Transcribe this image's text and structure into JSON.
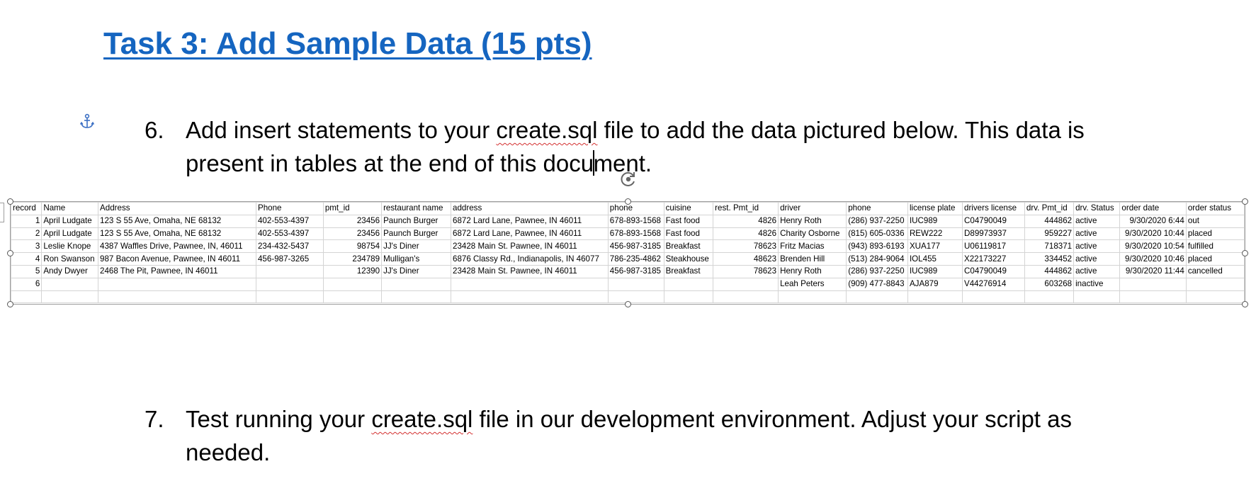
{
  "heading": "Task 3: Add Sample Data (15 pts)",
  "item6": {
    "number": "6.",
    "line1_pre": "Add insert statements to your ",
    "line1_file": "create.sql",
    "line1_post": " file to add the data pictured below. This data is",
    "line2_pre": "present in tables at the end of this docu",
    "line2_post": "ment."
  },
  "item7": {
    "number": "7.",
    "line1_pre": "Test running your ",
    "line1_file": "create.sql",
    "line1_post": " file in our development environment. Adjust your script as",
    "line2": "needed."
  },
  "table": {
    "headers": [
      "record",
      "Name",
      "Address",
      "Phone",
      "pmt_id",
      "restaurant name",
      "address",
      "phone",
      "cuisine",
      "rest. Pmt_id",
      "driver",
      "phone",
      "license plate",
      "drivers license",
      "drv. Pmt_id",
      "drv. Status",
      "order date",
      "order status"
    ],
    "numeric_columns": [
      0,
      4,
      9,
      14,
      16
    ],
    "rows": [
      [
        "1",
        "April Ludgate",
        "123 S 55 Ave, Omaha, NE 68132",
        "402-553-4397",
        "23456",
        "Paunch Burger",
        "6872 Lard Lane, Pawnee, IN 46011",
        "678-893-1568",
        "Fast food",
        "4826",
        "Henry Roth",
        "(286) 937-2250",
        "IUC989",
        "C04790049",
        "444862",
        "active",
        "9/30/2020 6:44",
        "out"
      ],
      [
        "2",
        "April Ludgate",
        "123 S 55 Ave, Omaha, NE 68132",
        "402-553-4397",
        "23456",
        "Paunch Burger",
        "6872 Lard Lane, Pawnee, IN 46011",
        "678-893-1568",
        "Fast food",
        "4826",
        "Charity Osborne",
        "(815) 605-0336",
        "REW222",
        "D89973937",
        "959227",
        "active",
        "9/30/2020 10:44",
        "placed"
      ],
      [
        "3",
        "Leslie Knope",
        "4387 Waffles Drive, Pawnee, IN, 46011",
        "234-432-5437",
        "98754",
        "JJ's Diner",
        "23428 Main St. Pawnee, IN 46011",
        "456-987-3185",
        "Breakfast",
        "78623",
        "Fritz Macias",
        "(943) 893-6193",
        "XUA177",
        "U06119817",
        "718371",
        "active",
        "9/30/2020 10:54",
        "fulfilled"
      ],
      [
        "4",
        "Ron Swanson",
        "987 Bacon Avenue, Pawnee, IN 46011",
        "456-987-3265",
        "234789",
        "Mulligan's",
        "6876 Classy Rd., Indianapolis, IN 46077",
        "786-235-4862",
        "Steakhouse",
        "48623",
        "Brenden Hill",
        "(513) 284-9064",
        "IOL455",
        "X22173227",
        "334452",
        "active",
        "9/30/2020 10:46",
        "placed"
      ],
      [
        "5",
        "Andy Dwyer",
        "2468 The Pit, Pawnee, IN 46011",
        "",
        "12390",
        "JJ's Diner",
        "23428 Main St. Pawnee, IN 46011",
        "456-987-3185",
        "Breakfast",
        "78623",
        "Henry Roth",
        "(286) 937-2250",
        "IUC989",
        "C04790049",
        "444862",
        "active",
        "9/30/2020 11:44",
        "cancelled"
      ],
      [
        "6",
        "",
        "",
        "",
        "",
        "",
        "",
        "",
        "",
        "",
        "Leah Peters",
        "(909) 477-8843",
        "AJA879",
        "V44276914",
        "603268",
        "inactive",
        "",
        ""
      ],
      [
        "",
        "",
        "",
        "",
        "",
        "",
        "",
        "",
        "",
        "",
        "",
        "",
        "",
        "",
        "",
        "",
        "",
        ""
      ]
    ]
  }
}
